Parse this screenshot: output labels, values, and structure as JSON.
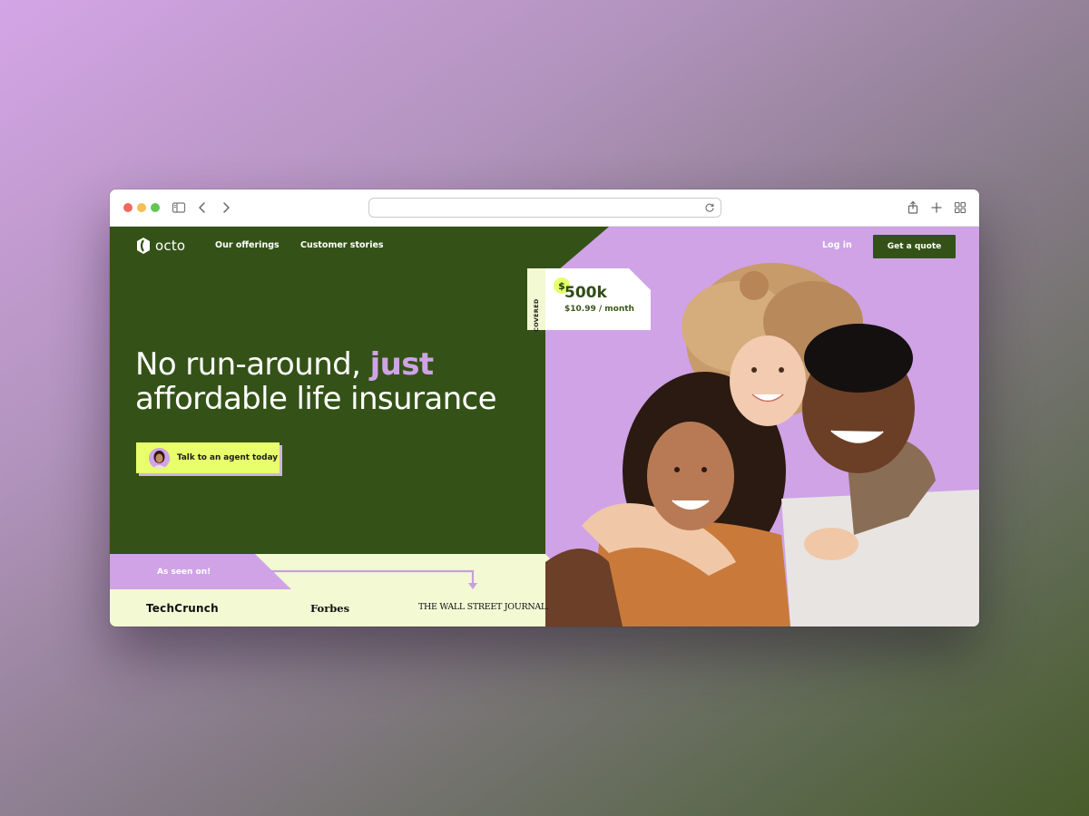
{
  "browser": {
    "url": "",
    "icons": [
      "sidebar-icon",
      "back-icon",
      "forward-icon",
      "reload-icon",
      "share-icon",
      "new-tab-icon",
      "tab-overview-icon"
    ]
  },
  "nav": {
    "logo_text": "octo",
    "links": [
      "Our offerings",
      "Customer stories"
    ],
    "login": "Log in",
    "cta": "Get a quote"
  },
  "hero": {
    "headline_part1": "No run-around,",
    "headline_accent": "just",
    "headline_line2": "affordable life insurance",
    "agent_button": "Talk to an agent today"
  },
  "coverage": {
    "vertical_label": "COVERED",
    "currency": "$",
    "amount": "500k",
    "price": "$10.99 / month"
  },
  "press": {
    "label": "As seen on!",
    "outlets": [
      "TechCrunch",
      "Forbes",
      "THE WALL STREET JOURNAL."
    ]
  },
  "colors": {
    "brand_green": "#345217",
    "lavender": "#cfa3e6",
    "lime": "#e8ff6b",
    "cream": "#f3f9d3"
  }
}
